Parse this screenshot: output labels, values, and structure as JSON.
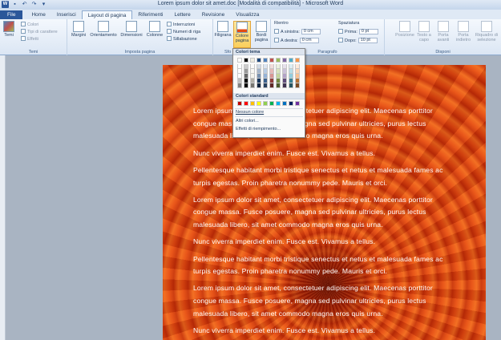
{
  "window": {
    "title": "Lorem ipsum dolor sit amet.doc [Modalità di compatibilità] - Microsoft Word"
  },
  "tabs": [
    {
      "label": "File"
    },
    {
      "label": "Home"
    },
    {
      "label": "Inserisci"
    },
    {
      "label": "Layout di pagina"
    },
    {
      "label": "Riferimenti"
    },
    {
      "label": "Lettere"
    },
    {
      "label": "Revisione"
    },
    {
      "label": "Visualizza"
    }
  ],
  "ribbon": {
    "temi": {
      "group_label": "Temi",
      "temi_button": "Temi",
      "colori": "Colori",
      "tipi_carattere": "Tipi di carattere",
      "effetti": "Effetti"
    },
    "imposta_pagina": {
      "group_label": "Imposta pagina",
      "margini": "Margini",
      "orientamento": "Orientamento",
      "dimensioni": "Dimensioni",
      "colonne": "Colonne",
      "interruzioni": "Interruzioni",
      "numeri_riga": "Numeri di riga",
      "sillabazione": "Sillabazione"
    },
    "sfondo": {
      "group_label": "Sfo",
      "filigrana": "Filigrana",
      "colore_pagina_1": "Colore",
      "colore_pagina_2": "pagina",
      "bordi_1": "Bordi",
      "bordi_2": "pagina"
    },
    "paragrafo": {
      "group_label": "Paragrafo",
      "rientro": "Rientro",
      "a_sinistra": "A sinistra:",
      "a_destra": "A destra:",
      "sx_value": "0 cm",
      "dx_value": "0 cm",
      "spaziatura": "Spaziatura",
      "prima": "Prima:",
      "dopo": "Dopo:",
      "prima_value": "0 pt",
      "dopo_value": "10 pt"
    },
    "disponi": {
      "group_label": "Disponi",
      "posizione": "Posizione",
      "testo_capo_1": "Testo a",
      "testo_capo_2": "capo",
      "porta_avanti_1": "Porta",
      "porta_avanti_2": "avanti",
      "porta_indietro_1": "Porta",
      "porta_indietro_2": "indietro",
      "riquadro_1": "Riquadro di",
      "riquadro_2": "selezione"
    }
  },
  "gallery": {
    "theme_header": "Colori tema",
    "standard_header": "Colori standard",
    "no_color": "Nessun colore",
    "more_colors": "Altri colori...",
    "fill_effects": "Effetti di riempimento...",
    "theme_colors": [
      "#ffffff",
      "#000000",
      "#eeece1",
      "#1f497d",
      "#4f81bd",
      "#c0504d",
      "#9bbb59",
      "#8064a2",
      "#4bacc6",
      "#f79646"
    ],
    "standard_colors": [
      "#c00000",
      "#ff0000",
      "#ffc000",
      "#ffff00",
      "#92d050",
      "#00b050",
      "#00b0f0",
      "#0070c0",
      "#002060",
      "#7030a0"
    ]
  },
  "document": {
    "paragraphs": [
      "Lorem ipsum dolor sit amet, consectetuer adipiscing elit. Maecenas porttitor congue massa. Fusce posuere, magna sed pulvinar ultricies, purus lectus malesuada libero, sit amet commodo magna eros quis urna.",
      "Nunc viverra imperdiet enim. Fusce est. Vivamus a tellus.",
      "Pellentesque habitant morbi tristique senectus et netus et malesuada fames ac turpis egestas. Proin pharetra nonummy pede. Mauris et orci.",
      "Lorem ipsum dolor sit amet, consectetuer adipiscing elit. Maecenas porttitor congue massa. Fusce posuere, magna sed pulvinar ultricies, purus lectus malesuada libero, sit amet commodo magna eros quis urna.",
      "Nunc viverra imperdiet enim. Fusce est. Vivamus a tellus.",
      "Pellentesque habitant morbi tristique senectus et netus et malesuada fames ac turpis egestas. Proin pharetra nonummy pede. Mauris et orci.",
      "Lorem ipsum dolor sit amet, consectetuer adipiscing elit. Maecenas porttitor congue massa. Fusce posuere, magna sed pulvinar ultricies, purus lectus malesuada libero, sit amet commodo magna eros quis urna.",
      "Nunc viverra imperdiet enim. Fusce est. Vivamus a tellus."
    ]
  }
}
